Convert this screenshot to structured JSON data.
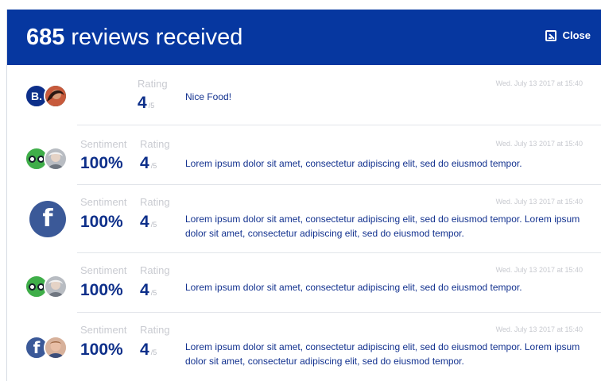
{
  "header": {
    "count": "685",
    "title_rest": "reviews received",
    "close_label": "Close"
  },
  "reviews": [
    {
      "source": "user-initial-b",
      "initial": "B.",
      "rating_label": "Rating",
      "rating": "4",
      "rating_out": "/5",
      "date": "Wed. July 13 2017 at 15:40",
      "text": "Nice Food!"
    },
    {
      "source": "tripadvisor",
      "sentiment_label": "Sentiment",
      "sentiment": "100%",
      "rating_label": "Rating",
      "rating": "4",
      "rating_out": "/5",
      "date": "Wed. July 13 2017 at 15:40",
      "text": "Lorem ipsum dolor sit amet, consectetur adipiscing elit, sed do eiusmod tempor."
    },
    {
      "source": "facebook",
      "sentiment_label": "Sentiment",
      "sentiment": "100%",
      "rating_label": "Rating",
      "rating": "4",
      "rating_out": "/5",
      "date": "Wed. July 13 2017 at 15:40",
      "text": "Lorem ipsum dolor sit amet, consectetur adipiscing elit, sed do eiusmod tempor. Lorem ipsum dolor sit amet, consectetur adipiscing elit, sed do eiusmod tempor."
    },
    {
      "source": "tripadvisor",
      "sentiment_label": "Sentiment",
      "sentiment": "100%",
      "rating_label": "Rating",
      "rating": "4",
      "rating_out": "/5",
      "date": "Wed. July 13 2017 at 15:40",
      "text": "Lorem ipsum dolor sit amet, consectetur adipiscing elit, sed do eiusmod tempor."
    },
    {
      "source": "facebook",
      "sentiment_label": "Sentiment",
      "sentiment": "100%",
      "rating_label": "Rating",
      "rating": "4",
      "rating_out": "/5",
      "date": "Wed. July 13 2017 at 15:40",
      "text": "Lorem ipsum dolor sit amet, consectetur adipiscing elit, sed do eiusmod tempor. Lorem ipsum dolor sit amet, consectetur adipiscing elit, sed do eiusmod tempor."
    }
  ],
  "colors": {
    "header_bg": "#0637a0",
    "accent_text": "#0d2f8a",
    "facebook": "#3b5998",
    "tripadvisor": "#3fae49"
  },
  "icons": {
    "close": "collapse-window-icon",
    "facebook": "facebook-icon",
    "tripadvisor": "tripadvisor-icon",
    "user_photo": "user-avatar-photo"
  }
}
